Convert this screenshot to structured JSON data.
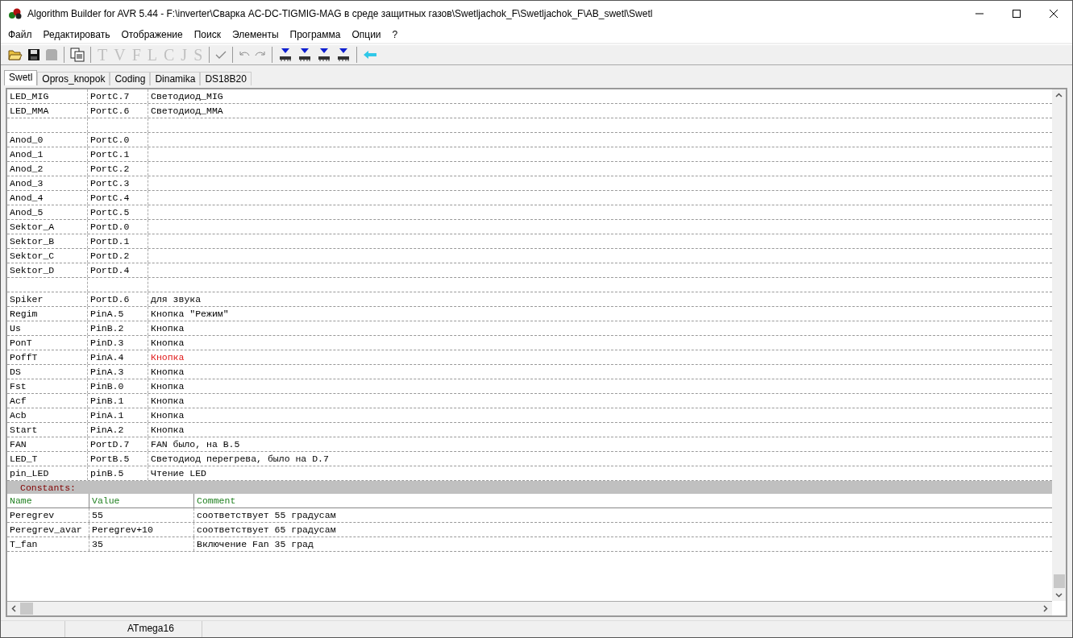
{
  "window": {
    "title": "Algorithm Builder for AVR 5.44 - F:\\inverter\\Сварка AC-DC-TIGMIG-MAG в среде защитных газов\\Swetljachok_F\\Swetljachok_F\\AB_swetl\\Swetl"
  },
  "menu": [
    "Файл",
    "Редактировать",
    "Отображение",
    "Поиск",
    "Элементы",
    "Программа",
    "Опции",
    "?"
  ],
  "toolbar": [
    {
      "kind": "open",
      "disabled": false
    },
    {
      "kind": "save",
      "disabled": false
    },
    {
      "kind": "disk",
      "disabled": true
    },
    {
      "kind": "sep"
    },
    {
      "kind": "copy",
      "disabled": false
    },
    {
      "kind": "sep"
    },
    {
      "kind": "letter",
      "label": "T",
      "disabled": true
    },
    {
      "kind": "letter",
      "label": "V",
      "disabled": true
    },
    {
      "kind": "letter",
      "label": "F",
      "disabled": true
    },
    {
      "kind": "letter",
      "label": "L",
      "disabled": true
    },
    {
      "kind": "letter",
      "label": "C",
      "disabled": true
    },
    {
      "kind": "letter",
      "label": "J",
      "disabled": true
    },
    {
      "kind": "letter",
      "label": "S",
      "disabled": true
    },
    {
      "kind": "sep"
    },
    {
      "kind": "check",
      "disabled": true
    },
    {
      "kind": "sep"
    },
    {
      "kind": "undo",
      "disabled": true
    },
    {
      "kind": "redo",
      "disabled": true
    },
    {
      "kind": "sep"
    },
    {
      "kind": "chip",
      "disabled": false
    },
    {
      "kind": "chip",
      "disabled": false
    },
    {
      "kind": "chip",
      "disabled": false
    },
    {
      "kind": "chip",
      "disabled": false
    },
    {
      "kind": "sep"
    },
    {
      "kind": "arrow",
      "disabled": false
    }
  ],
  "tabs": [
    {
      "label": "Swetl",
      "selected": true
    },
    {
      "label": "Opros_knopok",
      "selected": false
    },
    {
      "label": "Coding",
      "selected": false
    },
    {
      "label": "Dinamika",
      "selected": false
    },
    {
      "label": "DS18B20",
      "selected": false
    }
  ],
  "variables": [
    {
      "name": "LED_MIG",
      "port": "PortC.7",
      "comment": "Светодиод_MIG",
      "alert": false
    },
    {
      "name": "LED_MMA",
      "port": "PortC.6",
      "comment": "Светодиод_MMA",
      "alert": false
    },
    {
      "kind": "blank"
    },
    {
      "name": "Anod_0",
      "port": "PortC.0"
    },
    {
      "name": "Anod_1",
      "port": "PortC.1"
    },
    {
      "name": "Anod_2",
      "port": "PortC.2"
    },
    {
      "name": "Anod_3",
      "port": "PortC.3"
    },
    {
      "name": "Anod_4",
      "port": "PortC.4"
    },
    {
      "name": "Anod_5",
      "port": "PortC.5"
    },
    {
      "name": "Sektor_A",
      "port": "PortD.0"
    },
    {
      "name": "Sektor_B",
      "port": "PortD.1"
    },
    {
      "name": "Sektor_C",
      "port": "PortD.2"
    },
    {
      "name": "Sektor_D",
      "port": "PortD.4"
    },
    {
      "kind": "blank"
    },
    {
      "name": "Spiker",
      "port": "PortD.6",
      "comment": "для звука",
      "alert": false
    },
    {
      "name": "Regim",
      "port": "PinA.5",
      "comment": "Кнопка \"Режим\"",
      "alert": false
    },
    {
      "name": "Us",
      "port": "PinB.2",
      "comment": "Кнопка",
      "alert": false
    },
    {
      "name": "PonT",
      "port": "PinD.3",
      "comment": "Кнопка",
      "alert": false
    },
    {
      "name": "PoffT",
      "port": "PinA.4",
      "comment": "Кнопка",
      "alert": true
    },
    {
      "name": "DS",
      "port": "PinA.3",
      "comment": "Кнопка",
      "alert": false
    },
    {
      "name": "Fst",
      "port": "PinB.0",
      "comment": "Кнопка",
      "alert": false
    },
    {
      "name": "Acf",
      "port": "PinB.1",
      "comment": "Кнопка",
      "alert": false
    },
    {
      "name": "Acb",
      "port": "PinA.1",
      "comment": "Кнопка",
      "alert": false
    },
    {
      "name": "Start",
      "port": "PinA.2",
      "comment": "Кнопка",
      "alert": false
    },
    {
      "name": "FAN",
      "port": "PortD.7",
      "comment": "FAN было, на B.5",
      "alert": false
    },
    {
      "name": "LED_T",
      "port": "PortB.5",
      "comment": "Светодиод перегрева, было на D.7",
      "alert": false
    },
    {
      "name": "pin_LED",
      "port": "pinB.5",
      "comment": "Чтение LED",
      "alert": false
    }
  ],
  "constants": {
    "title": "Constants:",
    "columns": [
      "Name",
      "Value",
      "Comment"
    ],
    "rows": [
      [
        "Peregrev",
        "55",
        "соответствует 55 градусам"
      ],
      [
        "Peregrev_avar",
        "Peregrev+10",
        "соответствует 65 градусам"
      ],
      [
        "T_fan",
        "35",
        "Включение Fan 35 град"
      ]
    ]
  },
  "status_bar": {
    "device": "ATmega16"
  }
}
